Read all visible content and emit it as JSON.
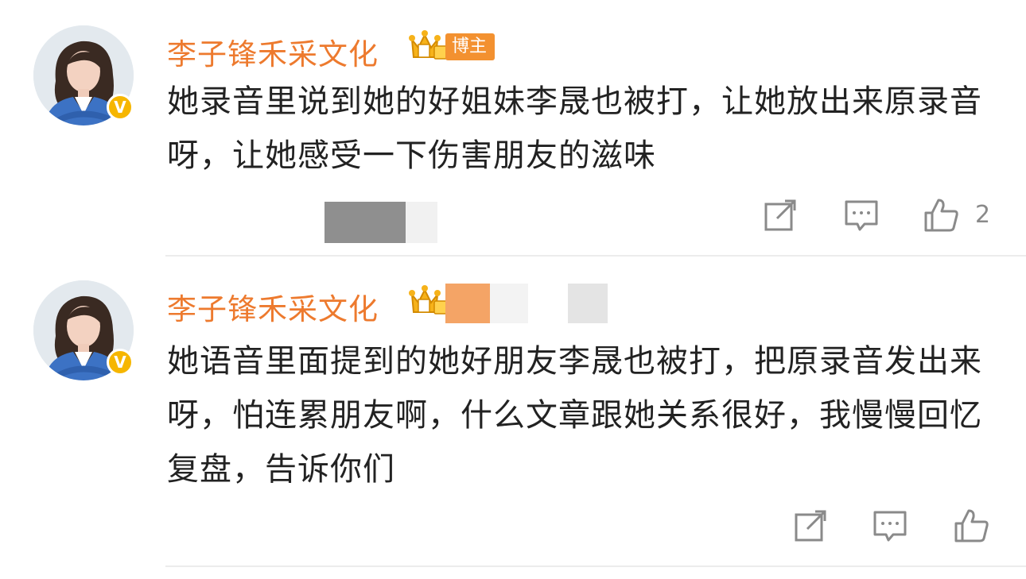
{
  "comments": [
    {
      "username": "李子锋禾采文化",
      "role_badge": "博主",
      "text": "她录音里说到她的好姐妹李晟也被打，让她放出来原录音呀，让她感受一下伤害朋友的滋味",
      "likes": "2",
      "icons": {
        "avatar": "avatar-photo",
        "verified": "verified-v-icon",
        "crown": "member-crown-icon",
        "repost": "repost-icon",
        "reply": "comment-icon",
        "like": "thumbs-up-icon"
      }
    },
    {
      "username": "李子锋禾采文化",
      "text": "她语音里面提到的她好朋友李晟也被打，把原录音发出来呀，怕连累朋友啊，什么文章跟她关系很好，我慢慢回忆复盘，告诉你们",
      "icons": {
        "avatar": "avatar-photo",
        "verified": "verified-v-icon",
        "crown": "member-crown-icon",
        "repost": "repost-icon",
        "reply": "comment-icon",
        "like": "thumbs-up-icon"
      }
    }
  ],
  "verified_mark": "V",
  "colors": {
    "username": "#ed7a2e",
    "badge": "#f39130",
    "verified": "#f6b600",
    "text": "#222222",
    "icon": "#8a8a8a"
  }
}
